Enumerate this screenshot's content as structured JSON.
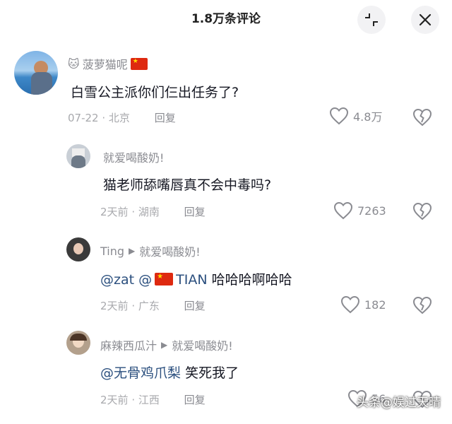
{
  "header": {
    "title": "1.8万条评论"
  },
  "comments": [
    {
      "author": "菠萝猫呢",
      "text": "白雪公主派你们仨出任务了?",
      "date": "07-22",
      "location": "北京",
      "reply": "回复",
      "likes": "4.8万"
    },
    {
      "author": "就爱喝酸奶!",
      "text": "猫老师舔嘴唇真不会中毒吗?",
      "date": "2天前",
      "location": "湖南",
      "reply": "回复",
      "likes": "7263"
    },
    {
      "author": "Ting",
      "reply_to": "就爱喝酸奶!",
      "mention1": "@zat",
      "mention2": "@",
      "mention3": "TIAN",
      "text": "哈哈哈啊哈哈",
      "date": "2天前",
      "location": "广东",
      "reply": "回复",
      "likes": "182"
    },
    {
      "author": "麻辣西瓜汁",
      "reply_to": "就爱喝酸奶!",
      "mention1": "@无骨鸡爪梨",
      "text": "笑死我了",
      "date": "2天前",
      "location": "江西",
      "reply": "回复",
      "likes": "56"
    }
  ],
  "watermark": "头条@娱过天晴",
  "colors": {
    "mention": "#2b4f7e",
    "meta": "#a8a9ad",
    "flag": "#de2910"
  },
  "icons": [
    "minimize-icon",
    "close-icon",
    "heart-icon",
    "broken-heart-icon",
    "cat-emoji",
    "china-flag"
  ]
}
